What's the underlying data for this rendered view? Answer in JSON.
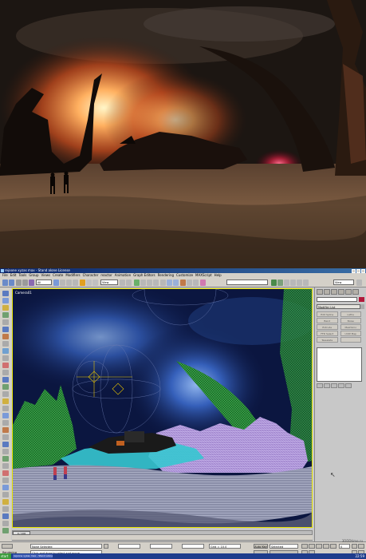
{
  "window": {
    "title": "rejoone xyzas max - Stand alone License"
  },
  "menu": [
    "File",
    "Edit",
    "Tools",
    "Group",
    "Views",
    "Create",
    "Modifiers",
    "Character",
    "reactor",
    "Animation",
    "Graph Editors",
    "Rendering",
    "Customize",
    "MAXScript",
    "Help"
  ],
  "toolbar": {
    "selection_filter": "All",
    "reference_coord": "View",
    "named_selection": "",
    "render_type": "View"
  },
  "viewport": {
    "label": "Camera01"
  },
  "command_panel": {
    "modifier_list": "Modifier List",
    "modifier_buttons": [
      "Edit Spline",
      "Lathe",
      "Bend",
      "Noise",
      "Extrude",
      "MeshSmo",
      "FFD Select",
      "UVW Map",
      "Tesselate",
      ""
    ]
  },
  "time_slider": {
    "frame": "0 / 100"
  },
  "status": {
    "selection": "None Selected",
    "prompt": "Click and drag to select and move",
    "grid": "Grid = 10,0",
    "auto_key": "Auto Key",
    "set_key_mode": "Selected",
    "frame": "0",
    "rendering": "Rendering"
  },
  "taskbar": {
    "start": "start",
    "task": "rejoone xyzas max - Stand alone",
    "clock": "22:59",
    "watermark": "3DDDtime.ru"
  },
  "colors": {
    "viewport_frame": "#e7e400",
    "wire_green": "#3ab04a",
    "wire_purple": "#b89ae0",
    "wire_cyan": "#38d0d8",
    "helper_yellow": "#e8c400"
  }
}
